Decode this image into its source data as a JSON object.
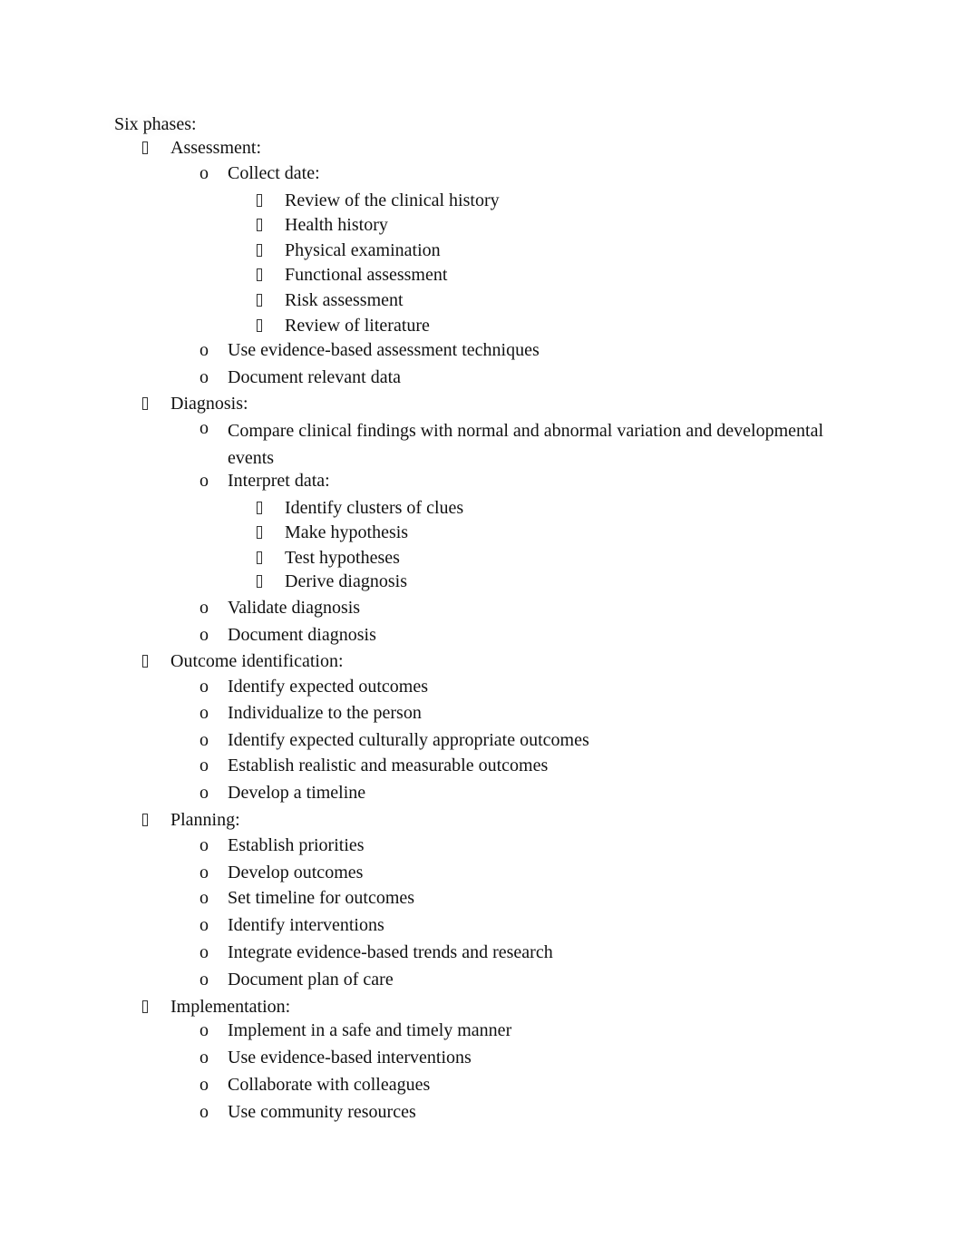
{
  "heading": "Six phases:",
  "bullets": {
    "level1": "missing-glyph-box",
    "level2": "o",
    "level3": "missing-glyph-box"
  },
  "rows": [
    {
      "level": 1,
      "text": "Assessment:"
    },
    {
      "level": 2,
      "text": "Collect date:"
    },
    {
      "level": 3,
      "text": "Review of the clinical history"
    },
    {
      "level": 3,
      "text": "Health history"
    },
    {
      "level": 3,
      "text": "Physical examination"
    },
    {
      "level": 3,
      "text": "Functional assessment"
    },
    {
      "level": 3,
      "text": "Risk assessment"
    },
    {
      "level": 3,
      "text": "Review of literature"
    },
    {
      "level": 2,
      "text": "Use evidence-based assessment techniques"
    },
    {
      "level": 2,
      "text": "Document relevant data"
    },
    {
      "level": 1,
      "text": "Diagnosis:"
    },
    {
      "level": 2,
      "text": "Compare clinical findings with normal and abnormal variation and developmental events"
    },
    {
      "level": 2,
      "text": "Interpret data:"
    },
    {
      "level": 3,
      "text": "Identify clusters of clues"
    },
    {
      "level": 3,
      "text": "Make hypothesis"
    },
    {
      "level": 3,
      "text": "Test hypotheses"
    },
    {
      "level": 3,
      "text": "Derive diagnosis"
    },
    {
      "level": 2,
      "text": "Validate diagnosis"
    },
    {
      "level": 2,
      "text": "Document diagnosis"
    },
    {
      "level": 1,
      "text": "Outcome identification:"
    },
    {
      "level": 2,
      "text": "Identify expected outcomes"
    },
    {
      "level": 2,
      "text": "Individualize to the person"
    },
    {
      "level": 2,
      "text": "Identify expected culturally appropriate outcomes"
    },
    {
      "level": 2,
      "text": "Establish realistic and measurable outcomes"
    },
    {
      "level": 2,
      "text": "Develop a timeline"
    },
    {
      "level": 1,
      "text": "Planning:"
    },
    {
      "level": 2,
      "text": "Establish priorities"
    },
    {
      "level": 2,
      "text": "Develop outcomes"
    },
    {
      "level": 2,
      "text": "Set timeline for outcomes"
    },
    {
      "level": 2,
      "text": "Identify interventions"
    },
    {
      "level": 2,
      "text": "Integrate evidence-based trends and research"
    },
    {
      "level": 2,
      "text": "Document plan of care"
    },
    {
      "level": 1,
      "text": "Implementation:"
    },
    {
      "level": 2,
      "text": "Implement in a safe and timely manner"
    },
    {
      "level": 2,
      "text": "Use evidence-based interventions"
    },
    {
      "level": 2,
      "text": "Collaborate with colleagues"
    },
    {
      "level": 2,
      "text": "Use community resources"
    }
  ]
}
